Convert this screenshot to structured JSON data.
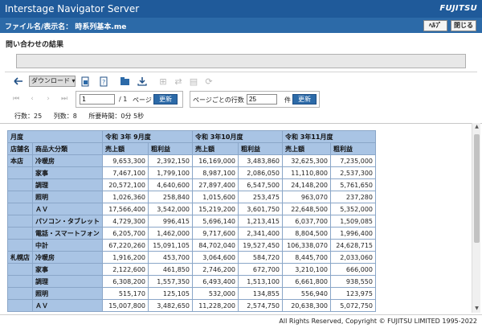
{
  "app": {
    "title": "Interstage Navigator Server",
    "logo": "FUJITSU"
  },
  "filebar": {
    "label": "ファイル名/表示名：  時系列基本.me",
    "help_label": "ﾍﾙﾌﾟ",
    "close_label": "閉じる"
  },
  "section_title": "問い合わせの結果",
  "toolbar": {
    "download_label": "ダウンロード",
    "icons": [
      "back-arrow-icon",
      "document-export-icon",
      "document-help-icon",
      "export-folder-icon",
      "download-icon",
      "transpose-icon",
      "swap-icon",
      "print-icon",
      "refresh-stack-icon"
    ]
  },
  "paging": {
    "current_page": "1",
    "total_pages": "/ 1",
    "page_label": "ページ",
    "update_label": "更新",
    "rows_per_page_label": "ページごとの行数",
    "rows_per_page_value": "25",
    "rows_unit": "件"
  },
  "stats": {
    "rows": "行数：25",
    "cols": "列数：8",
    "time": "所要時間：0分 5秒"
  },
  "table": {
    "corner_row1": "月度",
    "corner_row2_a": "店舗名",
    "corner_row2_b": "商品大分類",
    "months": [
      "令和 3年 9月度",
      "令和 3年10月度",
      "令和 3年11月度"
    ],
    "measures": [
      "売上額",
      "粗利益"
    ],
    "rows": [
      {
        "store": "本店",
        "cat": "冷暖房",
        "vals": [
          "9,653,300",
          "2,392,150",
          "16,169,000",
          "3,483,860",
          "32,625,300",
          "7,235,000"
        ]
      },
      {
        "store": "",
        "cat": "家事",
        "vals": [
          "7,467,100",
          "1,799,100",
          "8,987,100",
          "2,086,050",
          "11,110,800",
          "2,537,300"
        ]
      },
      {
        "store": "",
        "cat": "調理",
        "vals": [
          "20,572,100",
          "4,640,600",
          "27,897,400",
          "6,547,500",
          "24,148,200",
          "5,761,650"
        ]
      },
      {
        "store": "",
        "cat": "照明",
        "vals": [
          "1,026,360",
          "258,840",
          "1,015,600",
          "253,475",
          "963,070",
          "237,280"
        ]
      },
      {
        "store": "",
        "cat": "ＡＶ",
        "vals": [
          "17,566,400",
          "3,542,000",
          "15,219,200",
          "3,601,750",
          "22,648,500",
          "5,352,000"
        ]
      },
      {
        "store": "",
        "cat": "パソコン・タブレット",
        "vals": [
          "4,729,300",
          "996,415",
          "5,696,140",
          "1,213,415",
          "6,037,700",
          "1,509,085"
        ]
      },
      {
        "store": "",
        "cat": "電話・スマートフォン",
        "vals": [
          "6,205,700",
          "1,462,000",
          "9,717,600",
          "2,341,400",
          "8,804,500",
          "1,996,400"
        ]
      },
      {
        "store": "",
        "cat": "中計",
        "vals": [
          "67,220,260",
          "15,091,105",
          "84,702,040",
          "19,527,450",
          "106,338,070",
          "24,628,715"
        ]
      },
      {
        "store": "札幌店",
        "cat": "冷暖房",
        "vals": [
          "1,916,200",
          "453,700",
          "3,064,600",
          "584,720",
          "8,445,700",
          "2,033,060"
        ]
      },
      {
        "store": "",
        "cat": "家事",
        "vals": [
          "2,122,600",
          "461,850",
          "2,746,200",
          "672,700",
          "3,210,100",
          "666,000"
        ]
      },
      {
        "store": "",
        "cat": "調理",
        "vals": [
          "6,308,200",
          "1,557,350",
          "6,493,400",
          "1,513,100",
          "6,661,800",
          "938,550"
        ]
      },
      {
        "store": "",
        "cat": "照明",
        "vals": [
          "515,170",
          "125,105",
          "532,000",
          "134,855",
          "556,940",
          "123,975"
        ]
      },
      {
        "store": "",
        "cat": "ＡＶ",
        "vals": [
          "15,007,800",
          "3,482,650",
          "11,228,200",
          "2,574,750",
          "20,638,300",
          "5,072,750"
        ]
      }
    ]
  },
  "footer": {
    "copyright": "All Rights Reserved, Copyright © FUJITSU LIMITED 1995-2022"
  }
}
